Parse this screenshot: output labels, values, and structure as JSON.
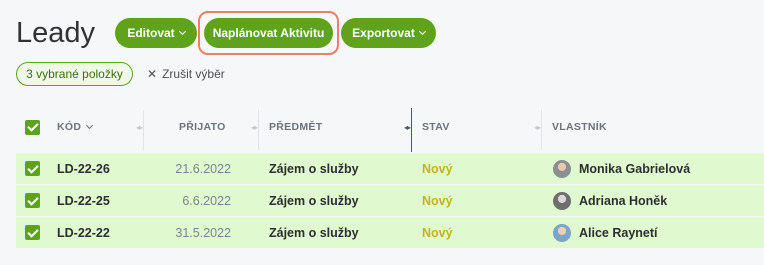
{
  "page": {
    "title": "Leady"
  },
  "toolbar": {
    "edit_label": "Editovat",
    "plan_label": "Naplánovat Aktivitu",
    "export_label": "Exportovat"
  },
  "selection": {
    "badge": "3 vybrané položky",
    "clear_label": "Zrušit výběr"
  },
  "table": {
    "columns": [
      "KÓD",
      "PŘIJATO",
      "PŘEDMĚT",
      "STAV",
      "VLASTNÍK"
    ],
    "rows": [
      {
        "code": "LD-22-26",
        "received": "21.6.2022",
        "subject": "Zájem o služby",
        "status": "Nový",
        "owner": "Monika Gabrielová"
      },
      {
        "code": "LD-22-25",
        "received": "6.6.2022",
        "subject": "Zájem o služby",
        "status": "Nový",
        "owner": "Adriana Honěk"
      },
      {
        "code": "LD-22-22",
        "received": "31.5.2022",
        "subject": "Zájem o služby",
        "status": "Nový",
        "owner": "Alice Raynetí"
      }
    ]
  },
  "colors": {
    "accent": "#5ea31b",
    "highlight": "#e8806a",
    "row_selected": "#e1f9cf",
    "status_new": "#c6b312"
  },
  "icons": {
    "chevron": "chevron-down-icon",
    "clear": "close-icon",
    "check": "checkbox-checked-icon"
  }
}
